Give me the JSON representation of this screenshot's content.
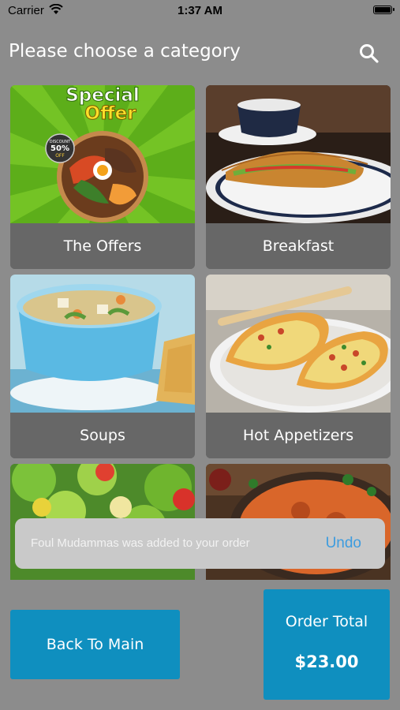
{
  "status_bar": {
    "carrier": "Carrier",
    "time": "1:37 AM"
  },
  "header": {
    "title": "Please choose a category",
    "search_icon": "search-icon"
  },
  "categories": [
    {
      "label": "The Offers",
      "promo_line1": "Special",
      "promo_line2": "Offer",
      "discount_badge": "DISCOUNT",
      "discount_value": "50%",
      "discount_off": "OFF"
    },
    {
      "label": "Breakfast"
    },
    {
      "label": "Soups"
    },
    {
      "label": "Hot Appetizers"
    },
    {
      "label": ""
    },
    {
      "label": ""
    }
  ],
  "toast": {
    "message": "Foul Mudammas was added to your order",
    "action": "Undo"
  },
  "footer": {
    "back_label": "Back To Main",
    "total_label": "Order Total",
    "total_value": "$23.00"
  },
  "colors": {
    "background": "#8c8c8c",
    "card_label_bg": "#676767",
    "accent": "#0f8fbf",
    "undo": "#3d9cdf"
  }
}
